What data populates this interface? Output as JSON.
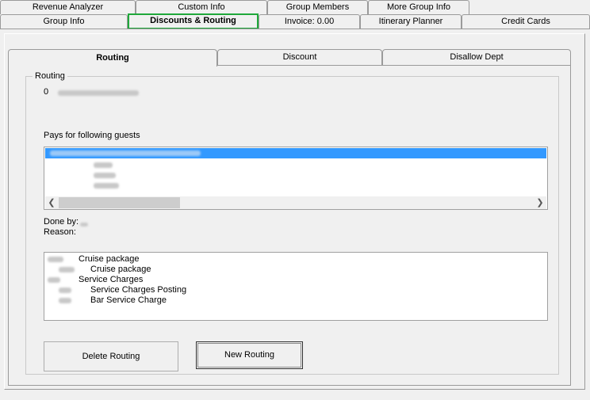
{
  "tabs_row1": [
    "Revenue Analyzer",
    "Custom Info",
    "Group Members",
    "More Group Info"
  ],
  "tabs_row2": [
    "Group Info",
    "Discounts & Routing",
    "Invoice: 0.00",
    "Itinerary Planner",
    "Credit Cards"
  ],
  "inner_tabs": [
    "Routing",
    "Discount",
    "Disallow Dept"
  ],
  "routing": {
    "group_label": "Routing",
    "number": "0",
    "pays_for_label": "Pays for following guests",
    "done_by_label": "Done by:",
    "reason_label": "Reason:",
    "departments": [
      {
        "name": "Cruise package",
        "indent": 0
      },
      {
        "name": "Cruise package",
        "indent": 1
      },
      {
        "name": "Service Charges",
        "indent": 0
      },
      {
        "name": "Service Charges Posting",
        "indent": 1
      },
      {
        "name": "Bar Service Charge",
        "indent": 1
      }
    ]
  },
  "buttons": {
    "delete_routing": "Delete Routing",
    "new_routing": "New Routing"
  },
  "colors": {
    "selection": "#3399ff",
    "active_tab_outline": "#1fa83a"
  }
}
